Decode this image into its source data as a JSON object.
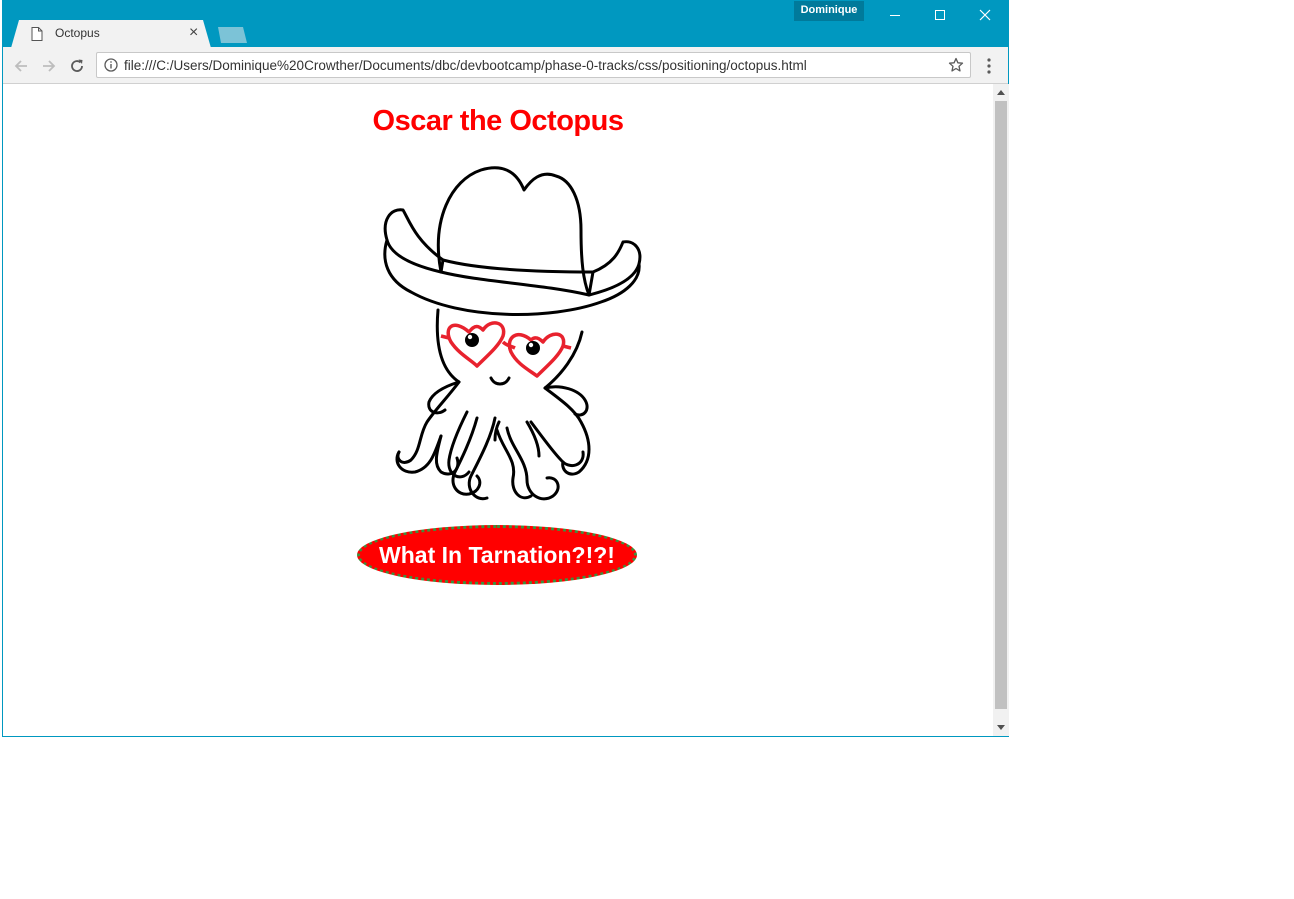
{
  "browser": {
    "tab_title": "Octopus",
    "tab_close": "×",
    "profile_name": "Dominique",
    "url": "file:///C:/Users/Dominique%20Crowther/Documents/dbc/devbootcamp/phase-0-tracks/css/positioning/octopus.html"
  },
  "page": {
    "title": "Oscar the Octopus",
    "banner_text": "What In Tarnation?!?!",
    "image_alt": "Octopus wearing a cowboy hat and heart-shaped glasses"
  },
  "colors": {
    "chrome_blue": "#0098c0",
    "title_red": "#ff0000",
    "banner_red": "#ff0000",
    "banner_border_green": "#3d8f3d",
    "glasses_red": "#e8222e"
  }
}
